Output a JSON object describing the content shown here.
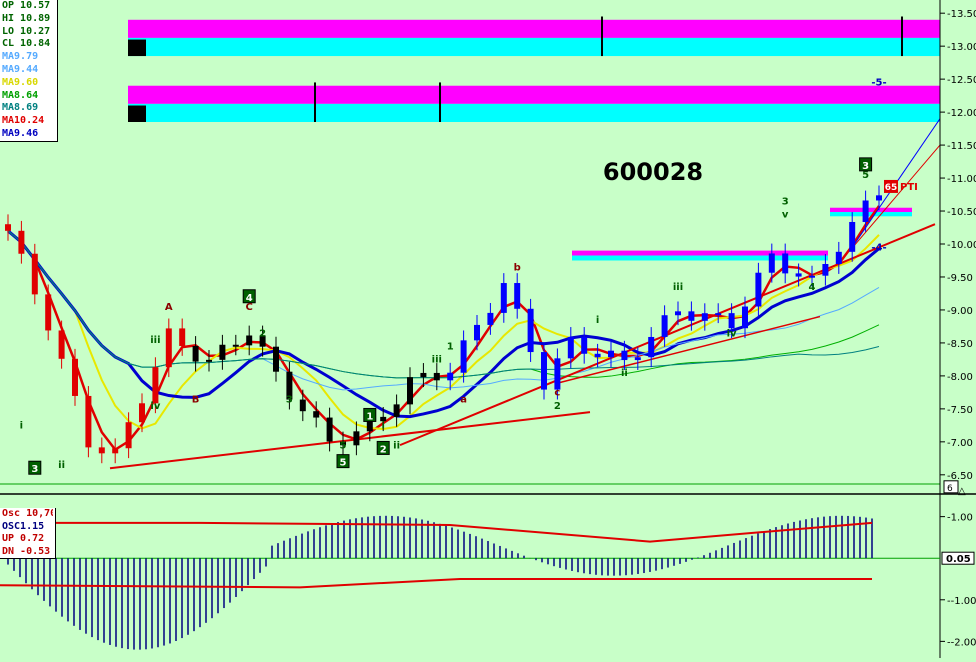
{
  "chart_data": [
    {
      "type": "candlestick",
      "title": "600028",
      "ylim": [
        6.3,
        13.7
      ],
      "y_ticks": [
        "13.50",
        "13.00",
        "12.50",
        "12.00",
        "11.50",
        "11.00",
        "10.50",
        "10.00",
        "9.50",
        "9.00",
        "8.50",
        "8.00",
        "7.50",
        "7.00",
        "6.50"
      ],
      "legend": [
        {
          "label": "OP 10.57",
          "color": "#006400"
        },
        {
          "label": "HI  10.89",
          "color": "#006400"
        },
        {
          "label": "LO  10.27",
          "color": "#006400"
        },
        {
          "label": "CL  10.84",
          "color": "#006400"
        },
        {
          "label": "MA9.79",
          "color": "#55aaff"
        },
        {
          "label": "MA9.44",
          "color": "#55aaff"
        },
        {
          "label": "MA9.60",
          "color": "#d8d800"
        },
        {
          "label": "MA8.64",
          "color": "#00a000"
        },
        {
          "label": "MA8.69",
          "color": "#008080"
        },
        {
          "label": "MA10.24",
          "color": "#e00000"
        },
        {
          "label": "MA9.46",
          "color": "#0000c0"
        }
      ],
      "price_labels": {
        "current": "6",
        "alt": "△"
      },
      "colors": {
        "up": "#0000ff",
        "down": "#e00000",
        "neutral": "#000000",
        "bg": "#c8ffc8",
        "magenta": "#ff00ff",
        "cyan": "#00ffff"
      },
      "wave_labels": [
        {
          "text": "3",
          "boxed": true,
          "x": 2,
          "y": 6.6
        },
        {
          "text": "ii",
          "boxed": false,
          "x": 4,
          "y": 6.6
        },
        {
          "text": "i",
          "boxed": false,
          "x": 1,
          "y": 7.2
        },
        {
          "text": "A",
          "boxed": false,
          "x": 12,
          "y": 9.0
        },
        {
          "text": "iii",
          "boxed": false,
          "x": 11,
          "y": 8.5
        },
        {
          "text": "iv",
          "boxed": false,
          "x": 11,
          "y": 7.5
        },
        {
          "text": "B",
          "boxed": false,
          "x": 14,
          "y": 7.6
        },
        {
          "text": "4",
          "boxed": true,
          "x": 18,
          "y": 9.2
        },
        {
          "text": "C",
          "boxed": false,
          "x": 18,
          "y": 9.0
        },
        {
          "text": "2",
          "boxed": false,
          "x": 19,
          "y": 8.6
        },
        {
          "text": "3",
          "boxed": false,
          "x": 21,
          "y": 7.6
        },
        {
          "text": "5",
          "boxed": false,
          "x": 25,
          "y": 6.9
        },
        {
          "text": "5",
          "boxed": true,
          "x": 25,
          "y": 6.7
        },
        {
          "text": "1",
          "boxed": true,
          "x": 27,
          "y": 7.4
        },
        {
          "text": "2",
          "boxed": true,
          "x": 28,
          "y": 6.9
        },
        {
          "text": "ii",
          "boxed": false,
          "x": 29,
          "y": 6.9
        },
        {
          "text": "i",
          "boxed": false,
          "x": 28,
          "y": 7.2
        },
        {
          "text": "iii",
          "boxed": false,
          "x": 32,
          "y": 8.2
        },
        {
          "text": "1",
          "boxed": false,
          "x": 33,
          "y": 8.4
        },
        {
          "text": "a",
          "boxed": false,
          "x": 34,
          "y": 7.6
        },
        {
          "text": "b",
          "boxed": false,
          "x": 38,
          "y": 9.6
        },
        {
          "text": "2",
          "boxed": false,
          "x": 41,
          "y": 7.5
        },
        {
          "text": "c",
          "boxed": false,
          "x": 41,
          "y": 7.7
        },
        {
          "text": "i",
          "boxed": false,
          "x": 44,
          "y": 8.8
        },
        {
          "text": "ii",
          "boxed": false,
          "x": 46,
          "y": 8.0
        },
        {
          "text": "iii",
          "boxed": false,
          "x": 50,
          "y": 9.3
        },
        {
          "text": "iv",
          "boxed": false,
          "x": 54,
          "y": 8.6
        },
        {
          "text": "3",
          "boxed": false,
          "x": 58,
          "y": 10.6
        },
        {
          "text": "v",
          "boxed": false,
          "x": 58,
          "y": 10.4
        },
        {
          "text": "4",
          "boxed": false,
          "x": 60,
          "y": 9.3
        },
        {
          "text": "5",
          "boxed": false,
          "x": 64,
          "y": 11.0
        },
        {
          "text": "3",
          "boxed": true,
          "x": 64,
          "y": 11.2
        },
        {
          "text": "-4-",
          "boxed": false,
          "x": 65,
          "y": 9.9
        },
        {
          "text": "-5-",
          "boxed": false,
          "x": 65,
          "y": 12.4
        }
      ],
      "pti_label": {
        "value": "65",
        "text": "PTI"
      }
    },
    {
      "type": "histogram",
      "name": "Osc",
      "ylim": [
        -2.4,
        1.4
      ],
      "y_ticks": [
        "1.00",
        "-1.00",
        "-2.00"
      ],
      "current_value": "0.05",
      "legend": [
        {
          "label": "Osc 10,70",
          "color": "#c00000"
        },
        {
          "label": "OSC1.15",
          "color": "#000080"
        },
        {
          "label": "UP  0.72",
          "color": "#c00000"
        },
        {
          "label": "DN  -0.53",
          "color": "#c00000"
        }
      ]
    }
  ]
}
